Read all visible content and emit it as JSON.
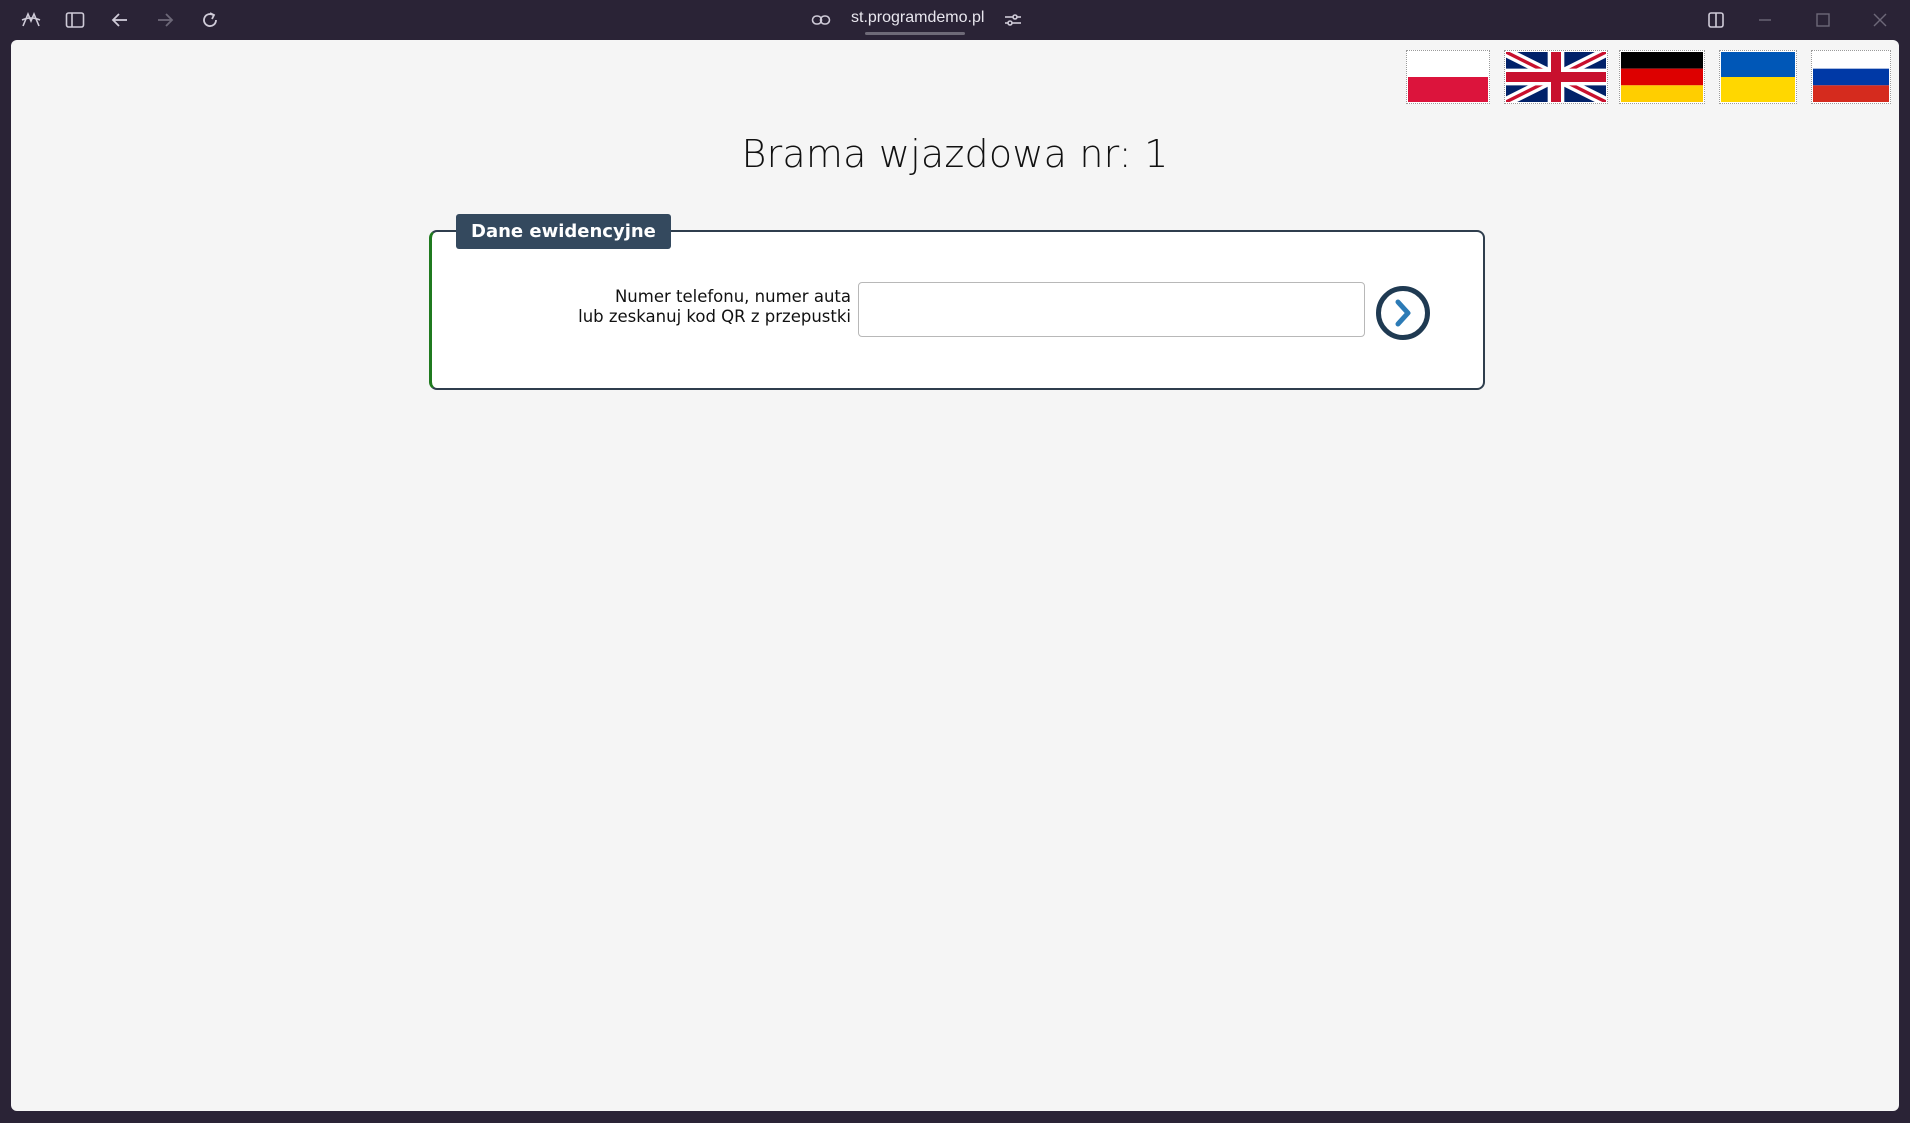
{
  "browser": {
    "url": "st.programdemo.pl",
    "icons": {
      "app": "aria-logo-icon",
      "sidebar": "sidebar-toggle-icon",
      "back": "arrow-left-icon",
      "forward": "arrow-right-icon",
      "reload": "reload-icon",
      "site_info": "link-icon",
      "tune": "sliders-icon",
      "split": "split-view-icon",
      "minimize": "minimize-icon",
      "maximize": "maximize-icon",
      "close": "close-icon"
    }
  },
  "languages": [
    {
      "code": "pl",
      "icon": "flag-poland-icon"
    },
    {
      "code": "en",
      "icon": "flag-uk-icon"
    },
    {
      "code": "de",
      "icon": "flag-germany-icon"
    },
    {
      "code": "uk",
      "icon": "flag-ukraine-icon"
    },
    {
      "code": "ru",
      "icon": "flag-russia-icon"
    }
  ],
  "page": {
    "title": "Brama wjazdowa nr: 1"
  },
  "form": {
    "legend": "Dane ewidencyjne",
    "label_line1": "Numer telefonu, numer auta",
    "label_line2": "lub zeskanuj kod QR z przepustki",
    "input_value": "",
    "input_placeholder": "",
    "submit_icon": "chevron-right-circle-icon"
  },
  "colors": {
    "chrome_bg": "#2a2336",
    "page_bg": "#f5f5f5",
    "legend_bg": "#34495e",
    "panel_border": "#2f3e4d",
    "panel_accent": "#1f7a1f",
    "button_ring": "#1f3a52",
    "button_arrow": "#2c7bb6"
  }
}
